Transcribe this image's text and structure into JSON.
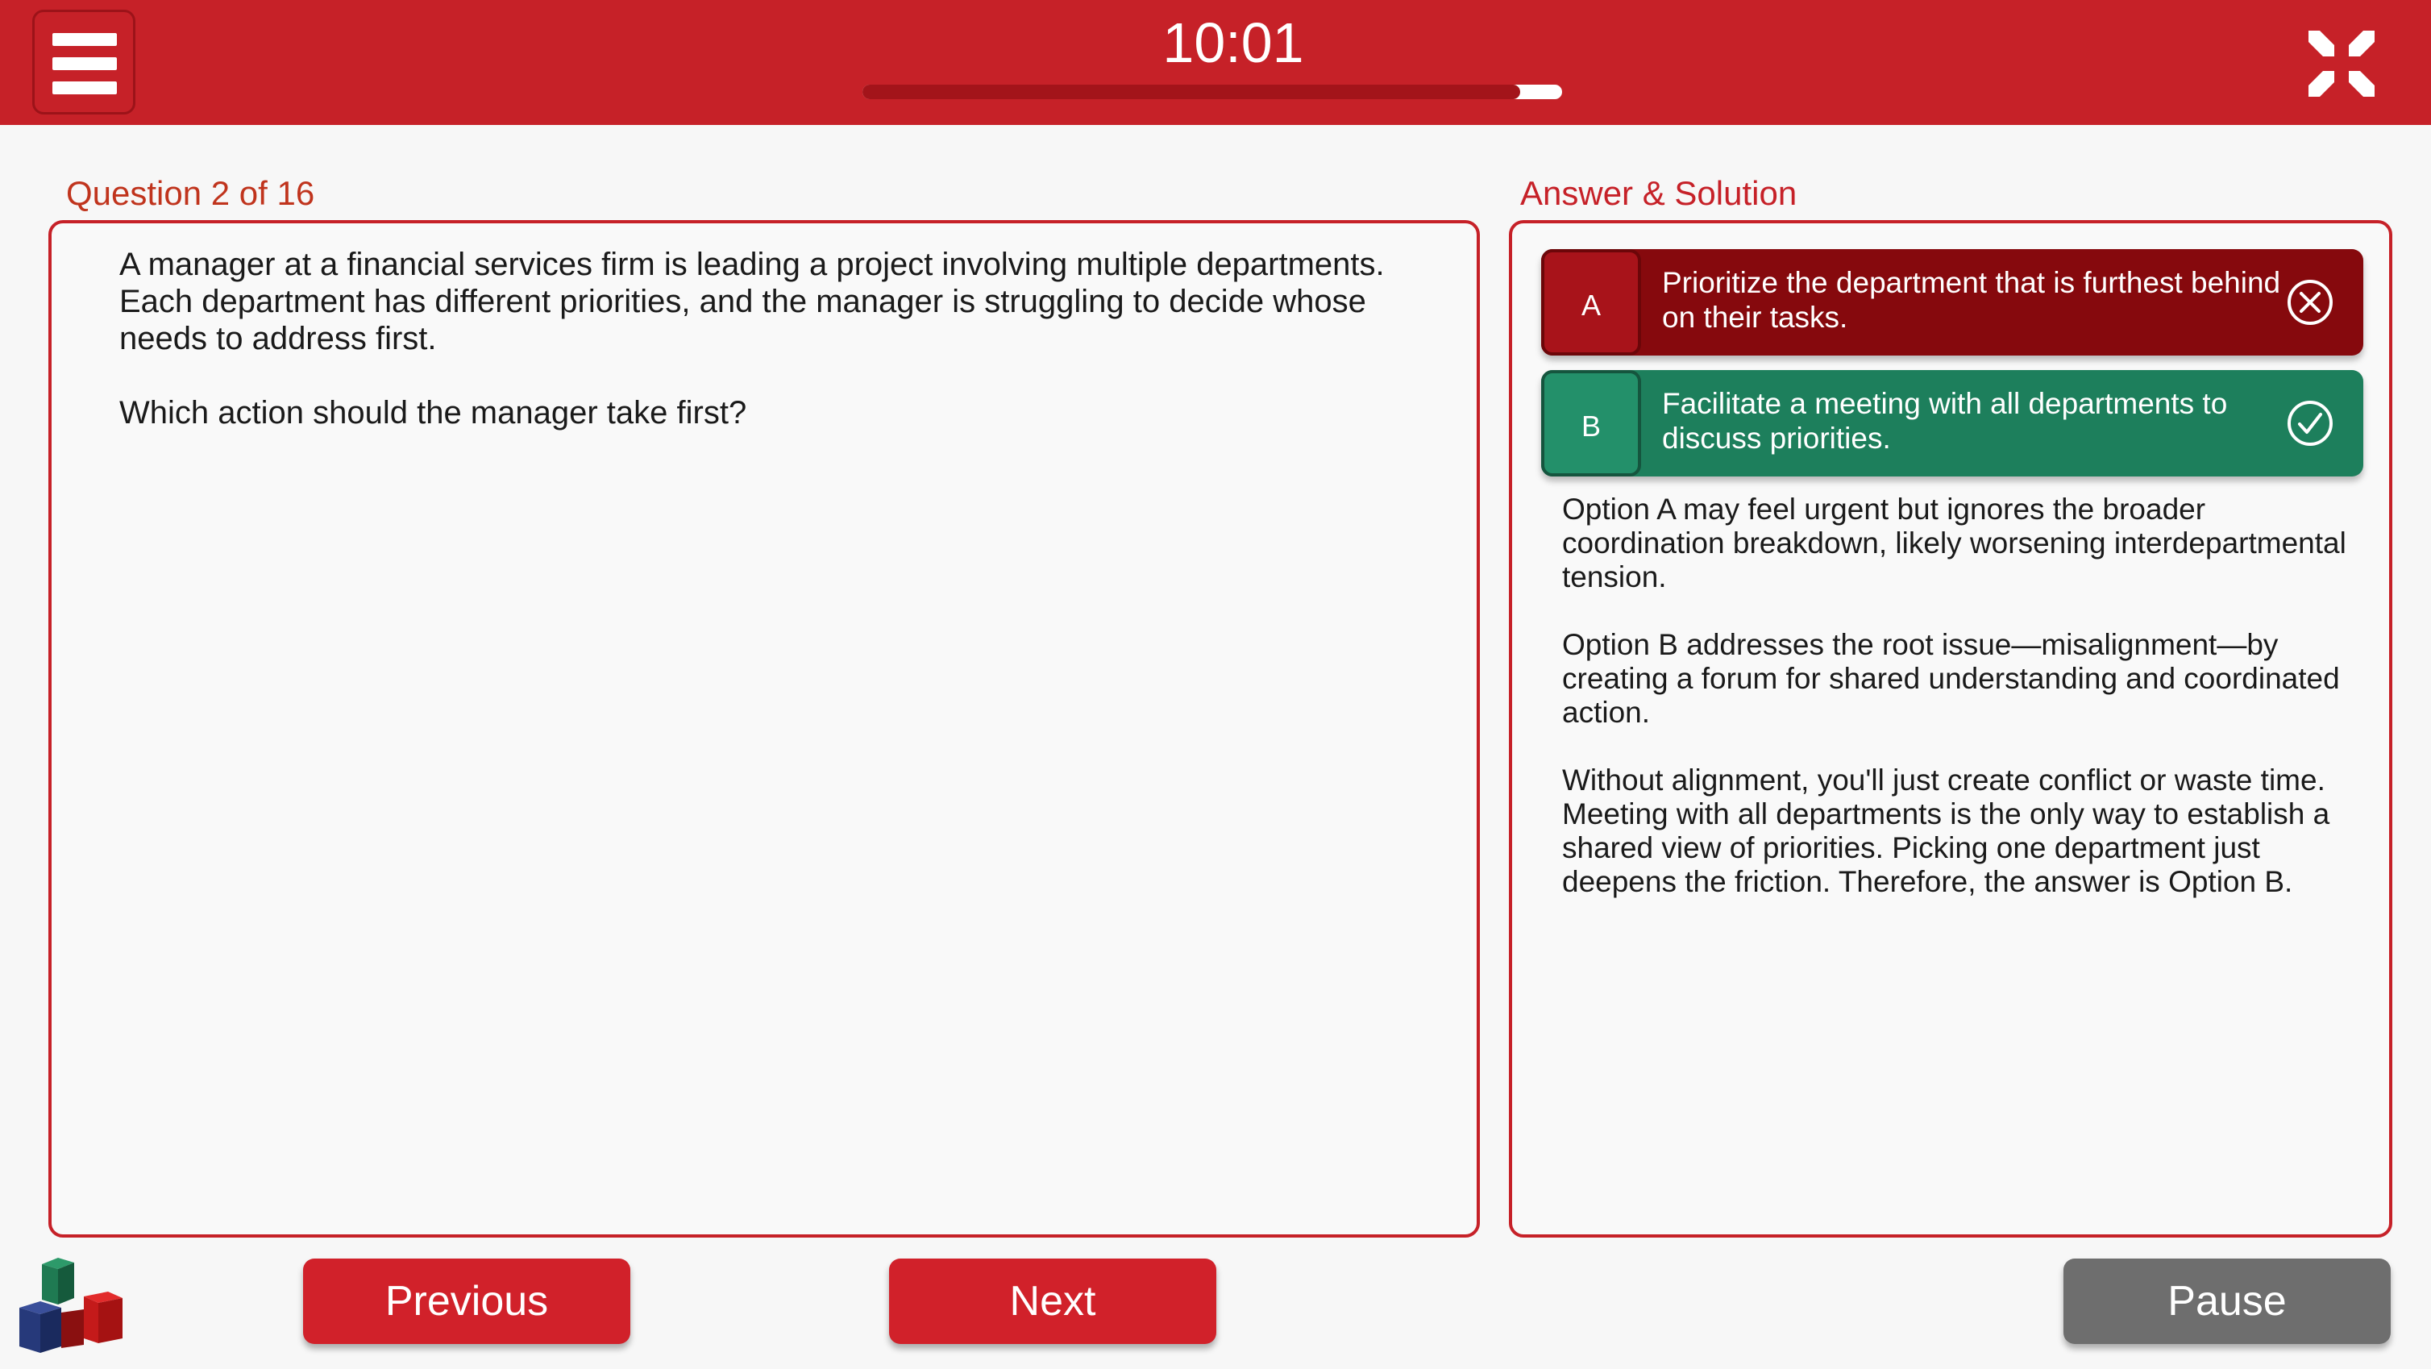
{
  "header": {
    "timer": "10:01",
    "progress_fraction": 0.94
  },
  "question": {
    "label": "Question 2 of 16",
    "paragraph_lines": [
      "A manager at a financial services firm is leading a project involving multiple departments.",
      "Each department has different priorities, and the manager is struggling to decide whose",
      "needs to address first."
    ],
    "prompt": "Which action should the manager take first?"
  },
  "answer": {
    "label": "Answer & Solution",
    "options": [
      {
        "letter": "A",
        "lines": [
          "Prioritize the department that is furthest behind",
          "on their tasks."
        ],
        "status": "incorrect",
        "icon": "x-circle-icon"
      },
      {
        "letter": "B",
        "lines": [
          "Facilitate a meeting with all departments to",
          "discuss priorities."
        ],
        "status": "correct",
        "icon": "check-circle-icon"
      }
    ],
    "solution": [
      [
        "Option A may feel urgent but ignores the broader",
        "coordination breakdown, likely worsening interdepartmental",
        "tension."
      ],
      [
        "Option B addresses the root issue—misalignment—by",
        "creating a forum for shared understanding and coordinated",
        "action."
      ],
      [
        "Without alignment, you'll just create conflict or waste time.",
        "Meeting with all departments is the only way to establish a",
        "shared view of priorities. Picking one department just",
        "deepens the friction. Therefore, the answer is Option B."
      ]
    ]
  },
  "footer": {
    "previous_label": "Previous",
    "next_label": "Next",
    "pause_label": "Pause"
  },
  "colors": {
    "brand_red": "#c62128",
    "incorrect": "#86090d",
    "correct": "#1d7f5c",
    "pause_gray": "#6e6e6e"
  }
}
